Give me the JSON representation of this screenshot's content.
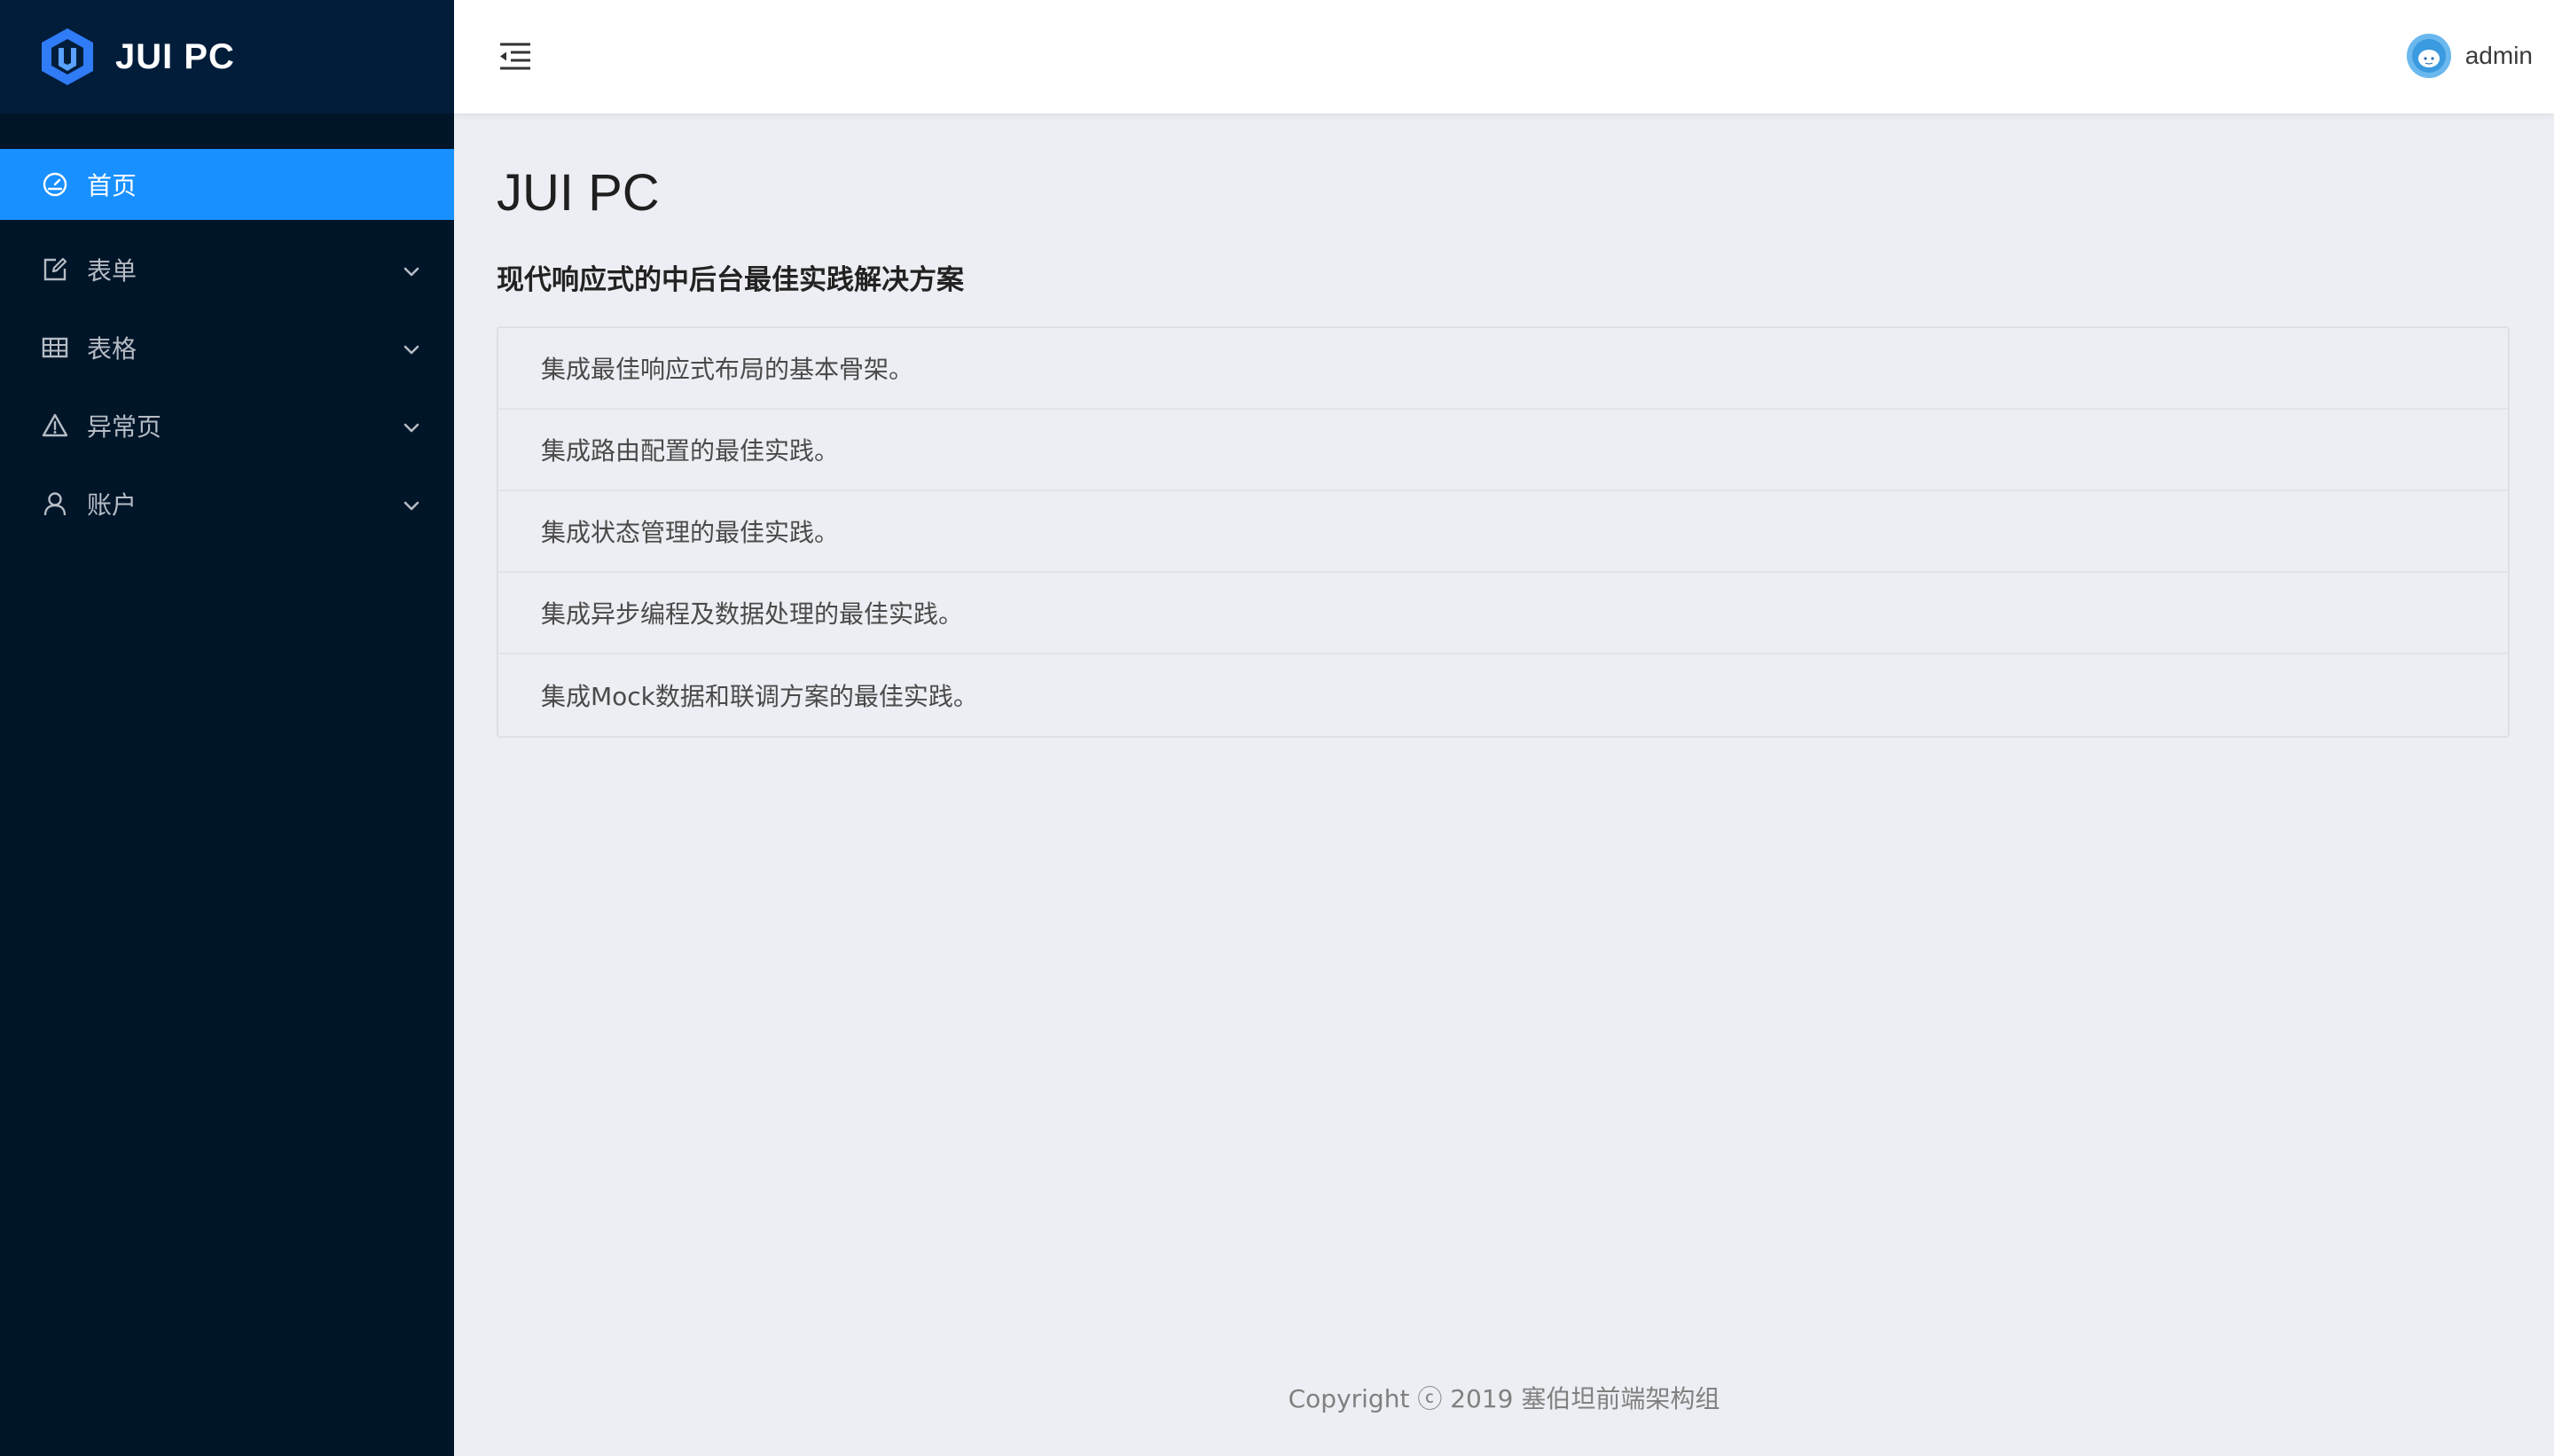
{
  "brand": {
    "name": "JUI PC",
    "accent_color": "#1990ff",
    "sidebar_color": "#011529"
  },
  "sidebar": {
    "items": [
      {
        "label": "首页",
        "icon": "dashboard-icon",
        "active": true
      },
      {
        "label": "表单",
        "icon": "edit-form-icon",
        "expandable": true
      },
      {
        "label": "表格",
        "icon": "table-icon",
        "expandable": true
      },
      {
        "label": "异常页",
        "icon": "warning-icon",
        "expandable": true
      },
      {
        "label": "账户",
        "icon": "user-icon",
        "expandable": true
      }
    ]
  },
  "header": {
    "collapse_icon": "menu-fold-icon",
    "username": "admin"
  },
  "main": {
    "title": "JUI PC",
    "subtitle": "现代响应式的中后台最佳实践解决方案",
    "features": [
      "集成最佳响应式布局的基本骨架。",
      "集成路由配置的最佳实践。",
      "集成状态管理的最佳实践。",
      "集成异步编程及数据处理的最佳实践。",
      "集成Mock数据和联调方案的最佳实践。"
    ]
  },
  "footer": {
    "copyright": "Copyright ⓒ 2019 塞伯坦前端架构组"
  }
}
